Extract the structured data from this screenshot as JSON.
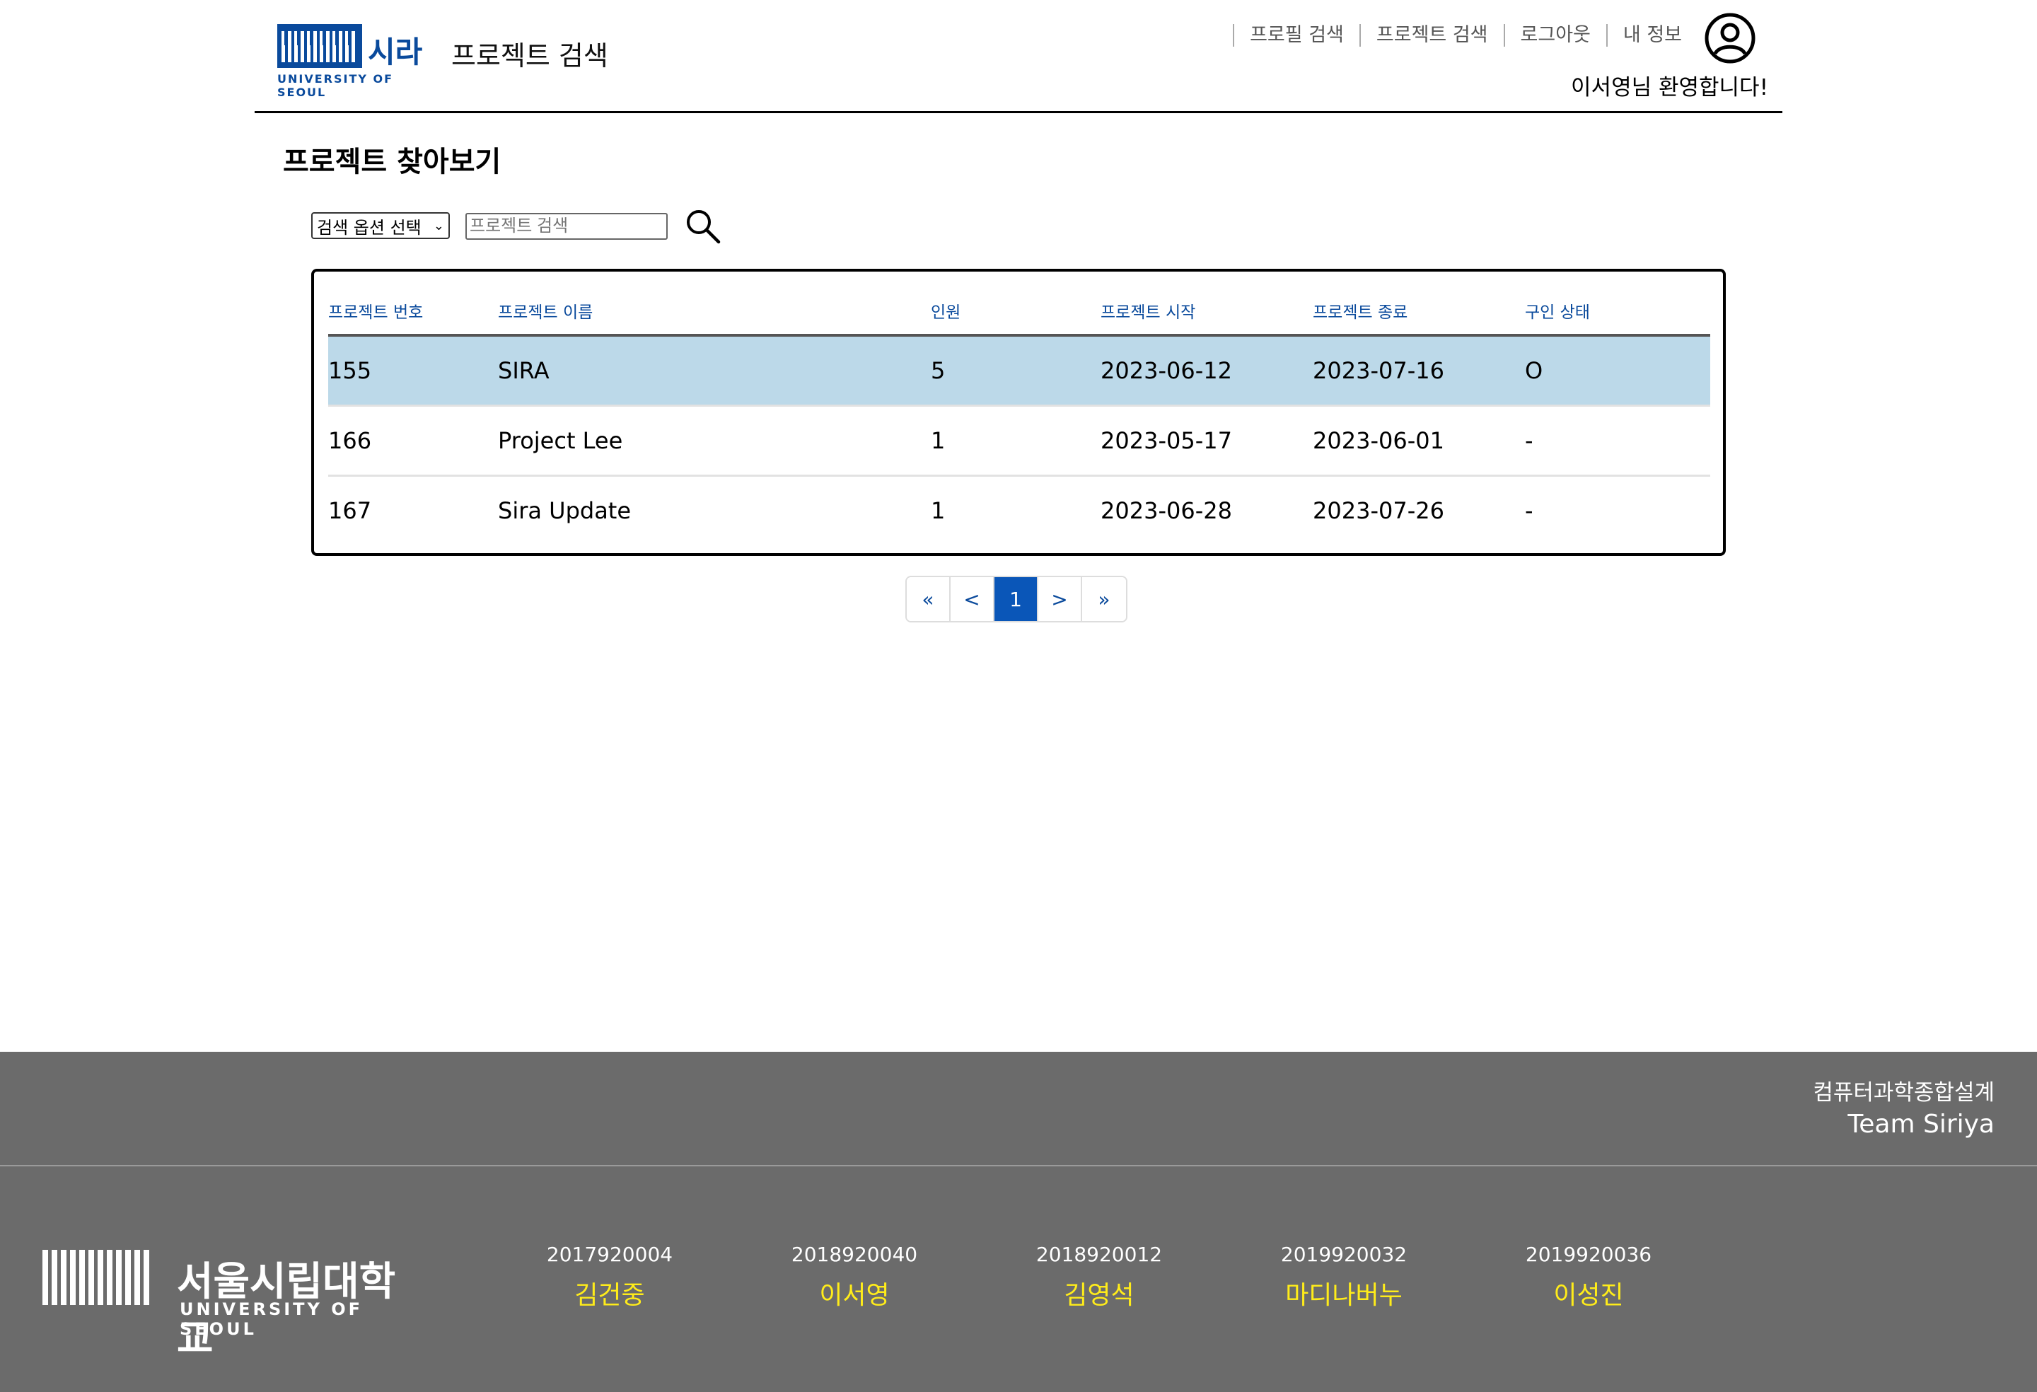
{
  "header": {
    "logo_text": "시라",
    "logo_sub": "UNIVERSITY OF SEOUL",
    "site_title": "프로젝트 검색",
    "nav": [
      "프로필 검색",
      "프로젝트 검색",
      "로그아웃",
      "내 정보"
    ],
    "welcome": "이서영님 환영합니다!"
  },
  "main": {
    "heading": "프로젝트 찾아보기",
    "search": {
      "option_label": "검색 옵션 선택",
      "placeholder": "프로젝트 검색"
    },
    "table": {
      "columns": [
        "프로젝트 번호",
        "프로젝트 이름",
        "인원",
        "프로젝트 시작",
        "프로젝트 종료",
        "구인 상태"
      ],
      "rows": [
        [
          "155",
          "SIRA",
          "5",
          "2023-06-12",
          "2023-07-16",
          "O"
        ],
        [
          "166",
          "Project Lee",
          "1",
          "2023-05-17",
          "2023-06-01",
          "-"
        ],
        [
          "167",
          "Sira Update",
          "1",
          "2023-06-28",
          "2023-07-26",
          "-"
        ]
      ],
      "selected_row": 0
    },
    "pagination": [
      "«",
      "<",
      "1",
      ">",
      "»"
    ],
    "current_page": "1"
  },
  "footer": {
    "course": "컴퓨터과학종합설계",
    "team": "Team Siriya",
    "logo_text": "서울시립대학교",
    "logo_sub": "UNIVERSITY OF SEOUL",
    "members": [
      {
        "id": "2017920004",
        "name": "김건중"
      },
      {
        "id": "2018920040",
        "name": "이서영"
      },
      {
        "id": "2018920012",
        "name": "김영석"
      },
      {
        "id": "2019920032",
        "name": "마디나버누"
      },
      {
        "id": "2019920036",
        "name": "이성진"
      }
    ]
  },
  "colors": {
    "brand_blue": "#0a4a9c",
    "selected_row": "#bcd9e9",
    "footer_bg": "#6b6b6b",
    "member_name": "#ffec1a"
  }
}
